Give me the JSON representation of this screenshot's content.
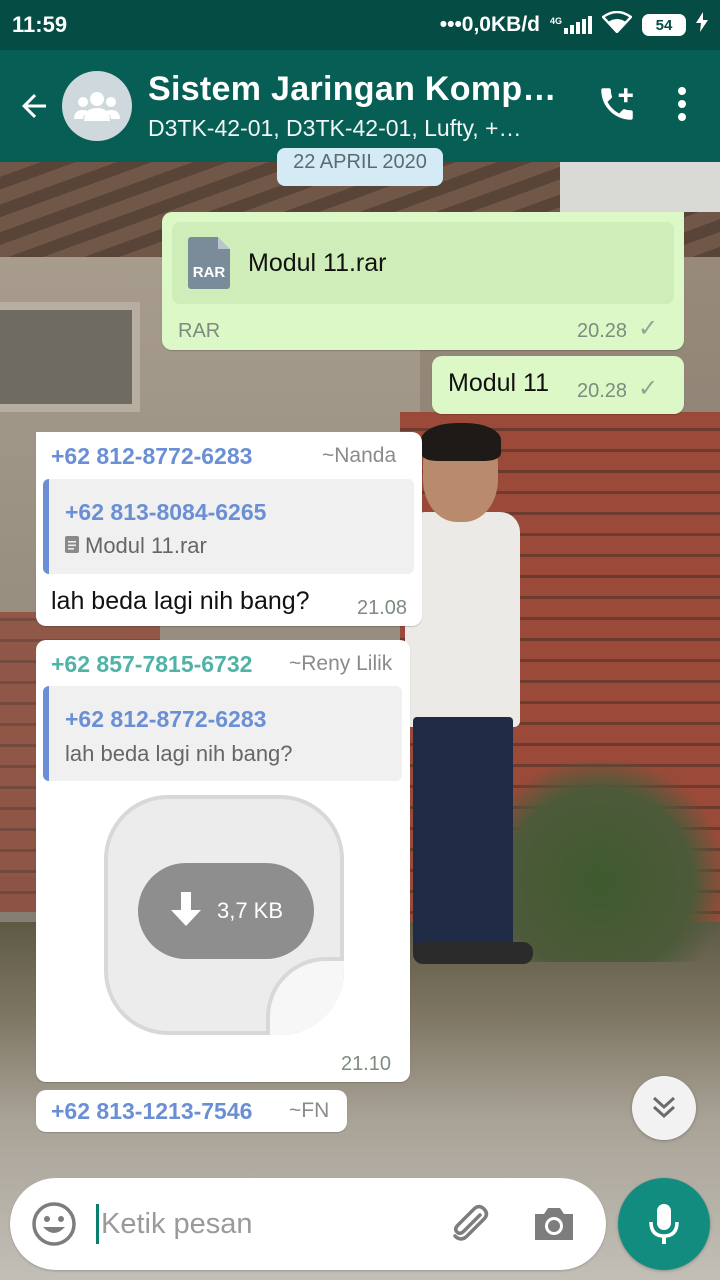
{
  "status_bar": {
    "time": "11:59",
    "network_speed": "•••0,0KB/d",
    "network_type": "4G",
    "battery": "54",
    "icons": [
      "signal-icon",
      "wifi-icon",
      "battery-icon",
      "charging-icon"
    ]
  },
  "header": {
    "title": "Sistem Jaringan Komp…",
    "subtitle": "D3TK-42-01, D3TK-42-01, Lufty, +…",
    "icons": [
      "back-arrow-icon",
      "group-avatar-icon",
      "add-call-icon",
      "more-vert-icon"
    ],
    "color": "#075e54"
  },
  "date_chip": "22 APRIL 2020",
  "messages": [
    {
      "type": "outgoing-file",
      "file_icon_label": "RAR",
      "file_name": "Modul 11.rar",
      "file_type": "RAR",
      "time": "20.28",
      "tick": "✓"
    },
    {
      "type": "outgoing-text",
      "text": "Modul 11",
      "time": "20.28",
      "tick": "✓"
    },
    {
      "type": "incoming-reply",
      "sender": "+62 812-8772-6283",
      "sender_color": "#6a8fd4",
      "alias": "~Nanda",
      "quoted_sender": "+62 813-8084-6265",
      "quoted_text": "Modul 11.rar",
      "text": "lah beda lagi nih bang?",
      "time": "21.08"
    },
    {
      "type": "incoming-sticker",
      "sender": "+62 857-7815-6732",
      "sender_color": "#4fb3a6",
      "alias": "~Reny Lilik",
      "quoted_sender": "+62 812-8772-6283",
      "quoted_text": "lah beda lagi nih bang?",
      "download_size": "3,7 KB",
      "time": "21.10"
    },
    {
      "type": "incoming-partial",
      "sender": "+62 813-1213-7546",
      "sender_color": "#6a8fd4",
      "alias": "~FN"
    }
  ],
  "composer": {
    "placeholder": "Ketik pesan",
    "icons": [
      "emoji-icon",
      "attach-icon",
      "camera-icon",
      "mic-icon"
    ],
    "mic_color": "#128c7e"
  }
}
